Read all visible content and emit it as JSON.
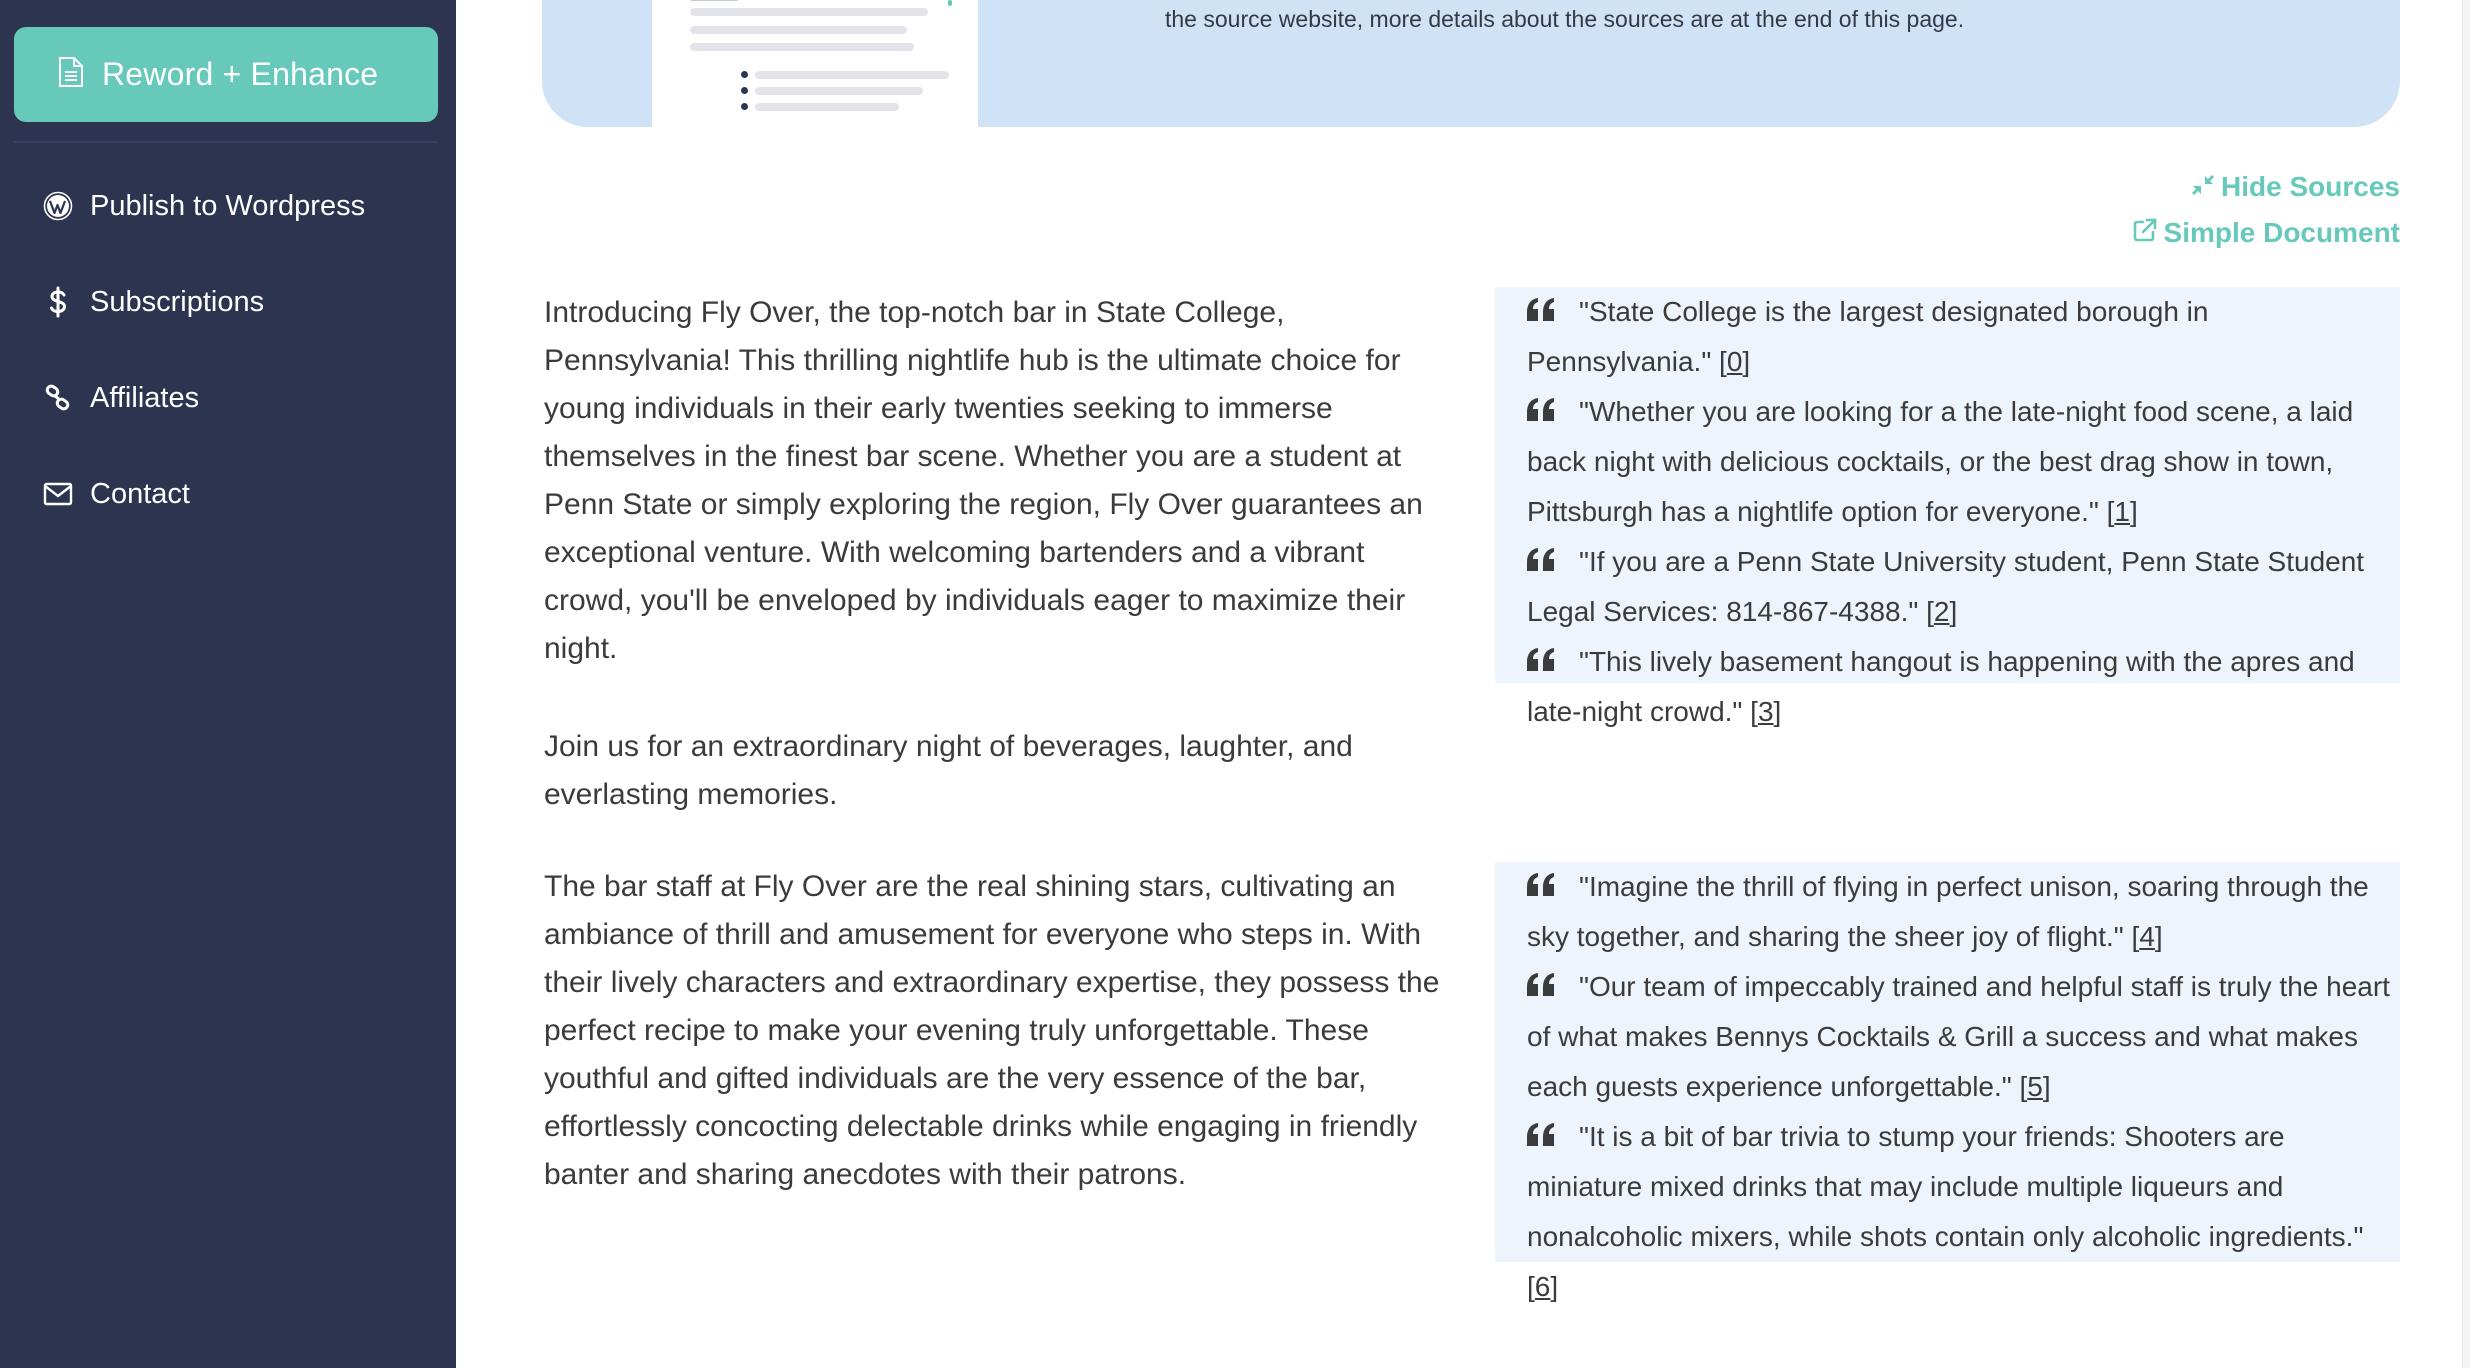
{
  "sidebar": {
    "primary_button": {
      "label": "Reword + Enhance",
      "icon": "document-icon"
    },
    "items": [
      {
        "label": "Publish to Wordpress",
        "icon": "wordpress-icon"
      },
      {
        "label": "Subscriptions",
        "icon": "dollar-icon"
      },
      {
        "label": "Affiliates",
        "icon": "link-icon"
      },
      {
        "label": "Contact",
        "icon": "envelope-icon"
      }
    ]
  },
  "banner": {
    "text": "the source website, more details about the sources are at the end of this page."
  },
  "actions": {
    "hide_sources": {
      "label": "Hide Sources",
      "icon": "compress-icon"
    },
    "simple_document": {
      "label": "Simple Document",
      "icon": "external-link-icon"
    }
  },
  "content": {
    "paragraphs": [
      "Introducing Fly Over, the top-notch bar in State College, Pennsylvania! This thrilling nightlife hub is the ultimate choice for young individuals in their early twenties seeking to immerse themselves in the finest bar scene. Whether you are a student at Penn State or simply exploring the region, Fly Over guarantees an exceptional venture. With welcoming bartenders and a vibrant crowd, you'll be enveloped by individuals eager to maximize their night.",
      "Join us for an extraordinary night of beverages, laughter, and everlasting memories.",
      "The bar staff at Fly Over are the real shining stars, cultivating an ambiance of thrill and amusement for everyone who steps in. With their lively characters and extraordinary expertise, they possess the perfect recipe to make your evening truly unforgettable. These youthful and gifted individuals are the very essence of the bar, effortlessly concocting delectable drinks while engaging in friendly banter and sharing anecdotes with their patrons."
    ],
    "source_groups": [
      [
        {
          "quote": "\"State College is the largest designated borough in Pennsylvania.\"",
          "ref": "0"
        },
        {
          "quote": "\"Whether you are looking for a the late-night food scene, a laid back night with delicious cocktails, or the best drag show in town, Pittsburgh has a nightlife option for everyone.\"",
          "ref": "1"
        },
        {
          "quote": "\"If you are a Penn State University student, Penn State Student Legal Services: 814-867-4388.\"",
          "ref": "2"
        },
        {
          "quote": "\"This lively basement hangout is happening with the apres and late-night crowd.\"",
          "ref": "3"
        }
      ],
      [
        {
          "quote": "\"Imagine the thrill of flying in perfect unison, soaring through the sky together, and sharing the sheer joy of flight.\"",
          "ref": "4"
        },
        {
          "quote": "\"Our team of impeccably trained and helpful staff is truly the heart of what makes Bennys Cocktails & Grill a success and what makes each guests experience unforgettable.\"",
          "ref": "5"
        },
        {
          "quote": "\"It is a bit of bar trivia to stump your friends: Shooters are miniature mixed drinks that may include multiple liqueurs and nonalcoholic mixers, while shots contain only alcoholic ingredients.\"",
          "ref": "6"
        }
      ]
    ]
  },
  "colors": {
    "sidebar_bg": "#2c344f",
    "accent": "#66c9ba",
    "banner_bg": "#d0e2f6",
    "source_bg": "#eef4fb",
    "text": "#3b3b3b"
  }
}
